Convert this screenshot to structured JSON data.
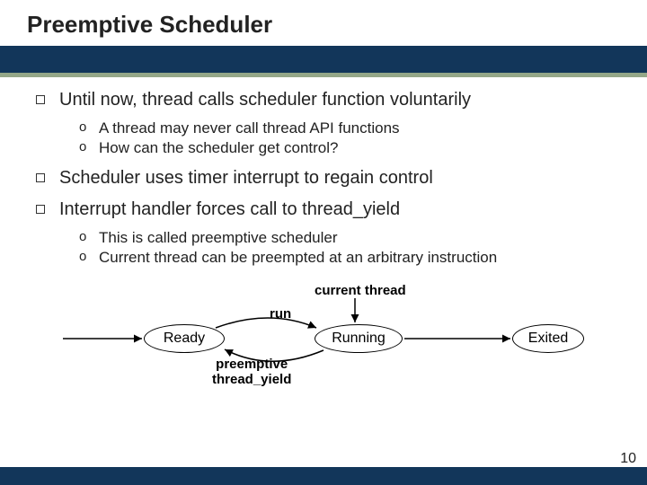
{
  "title": "Preemptive Scheduler",
  "bullets": [
    {
      "text": "Until now, thread calls scheduler function voluntarily",
      "subs": [
        "A thread may never call thread API functions",
        "How can the scheduler get control?"
      ]
    },
    {
      "text": "Scheduler uses timer interrupt to regain control",
      "subs": []
    },
    {
      "text": "Interrupt handler forces call to thread_yield",
      "subs": [
        "This is called preemptive scheduler",
        "Current thread can be preempted at an arbitrary instruction"
      ]
    }
  ],
  "diagram": {
    "current_thread": "current thread",
    "run": "run",
    "preempt1": "preemptive",
    "preempt2": "thread_yield",
    "ready": "Ready",
    "running": "Running",
    "exited": "Exited"
  },
  "page": "10"
}
